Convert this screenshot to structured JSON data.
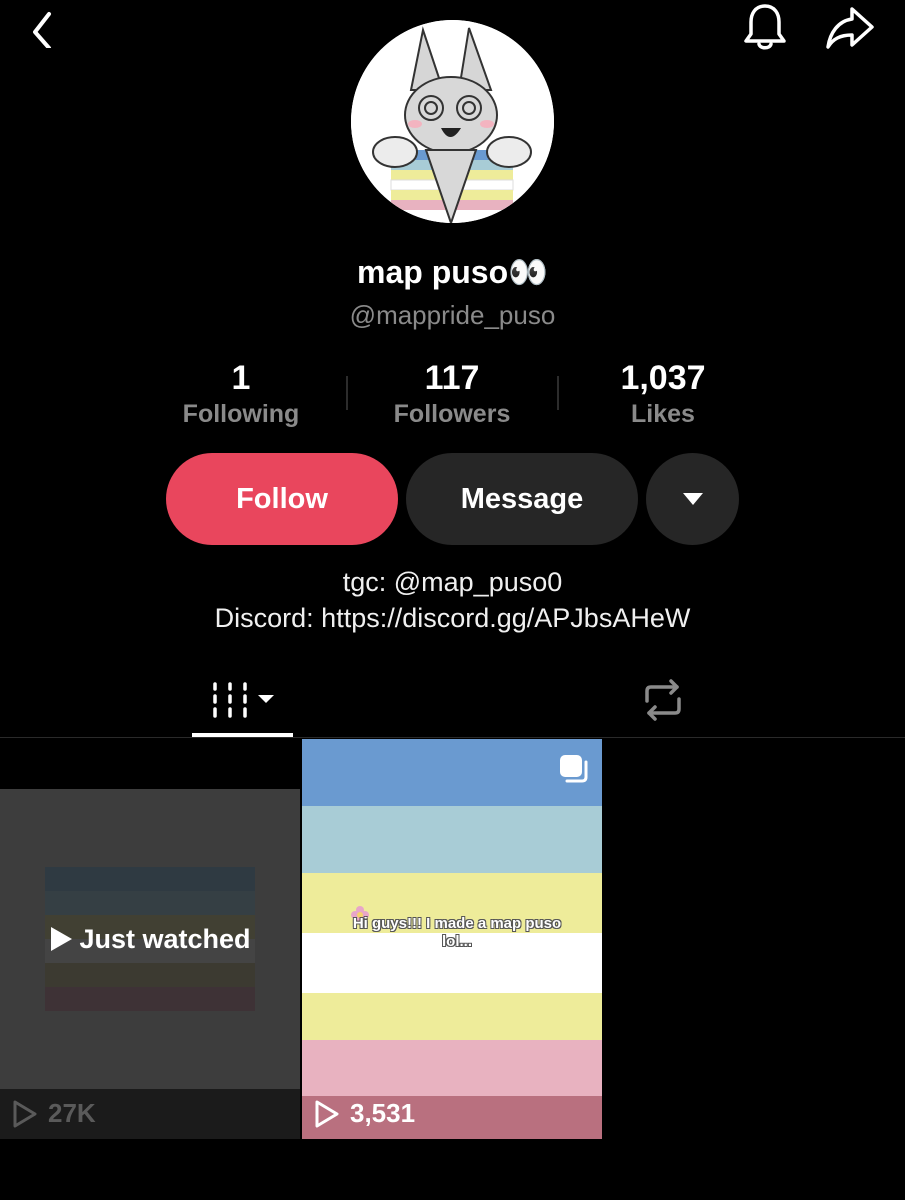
{
  "profile": {
    "display_name": "map puso👀",
    "handle": "@mappride_puso"
  },
  "stats": [
    {
      "value": "1",
      "label": "Following"
    },
    {
      "value": "117",
      "label": "Followers"
    },
    {
      "value": "1,037",
      "label": "Likes"
    }
  ],
  "actions": {
    "follow": "Follow",
    "message": "Message"
  },
  "bio": {
    "line1": "tgc: @map_puso0",
    "line2": "Discord: https://discord.gg/APJbsAHeW"
  },
  "tabs": {
    "active": "videos"
  },
  "videos": [
    {
      "overlay_label": "Just watched",
      "views": "27K"
    },
    {
      "caption": "Hi guys!!! I made a map puso lol...",
      "views": "3,531"
    }
  ],
  "colors": {
    "accent": "#e9465d",
    "background": "#000000",
    "stripes": [
      "#6a9ad0",
      "#a8ccd6",
      "#eeec9a",
      "#ffffff",
      "#eeec9a",
      "#e8b2c0",
      "#b9707f"
    ]
  }
}
